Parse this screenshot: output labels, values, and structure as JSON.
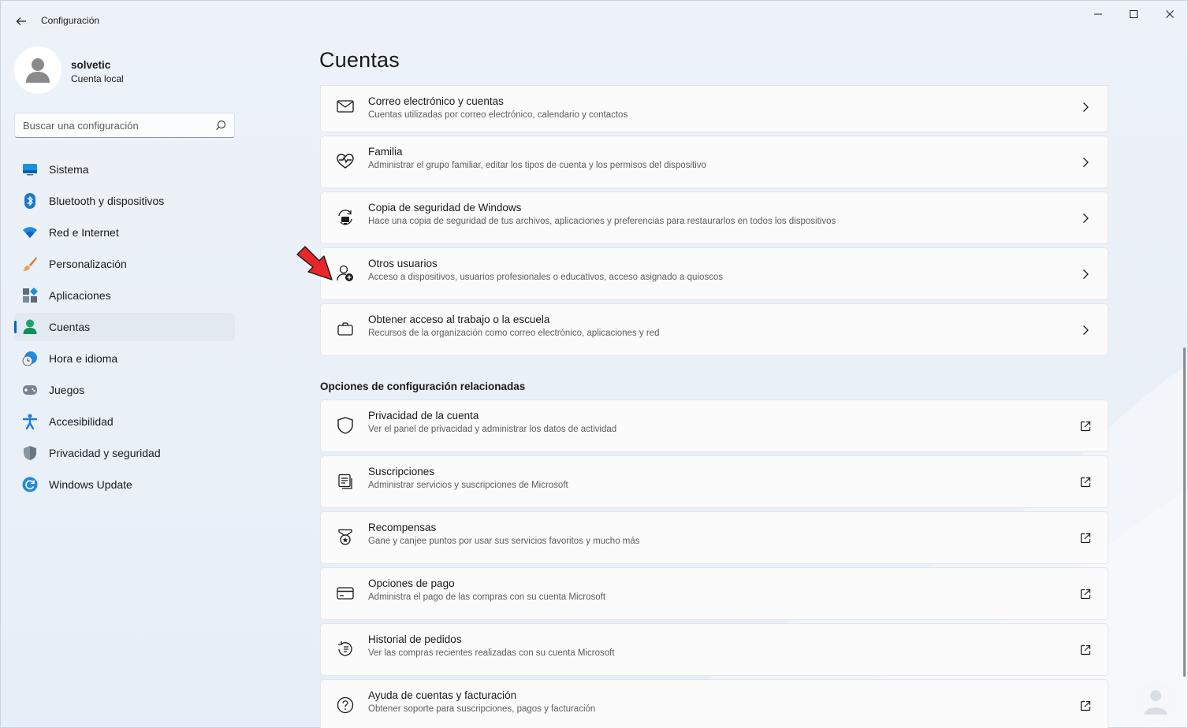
{
  "window": {
    "title": "Configuración"
  },
  "profile": {
    "name": "solvetic",
    "account_type": "Cuenta local"
  },
  "search": {
    "placeholder": "Buscar una configuración"
  },
  "nav": {
    "items": [
      {
        "label": "Sistema",
        "icon": "monitor-icon"
      },
      {
        "label": "Bluetooth y dispositivos",
        "icon": "bluetooth-icon"
      },
      {
        "label": "Red e Internet",
        "icon": "wifi-icon"
      },
      {
        "label": "Personalización",
        "icon": "brush-icon"
      },
      {
        "label": "Aplicaciones",
        "icon": "apps-icon"
      },
      {
        "label": "Cuentas",
        "icon": "account-icon",
        "active": true
      },
      {
        "label": "Hora e idioma",
        "icon": "clock-globe-icon"
      },
      {
        "label": "Juegos",
        "icon": "gamepad-icon"
      },
      {
        "label": "Accesibilidad",
        "icon": "accessibility-icon"
      },
      {
        "label": "Privacidad y seguridad",
        "icon": "shield-icon"
      },
      {
        "label": "Windows Update",
        "icon": "update-icon"
      }
    ]
  },
  "main": {
    "title": "Cuentas",
    "settings": [
      {
        "title": "Correo electrónico y cuentas",
        "subtitle": "Cuentas utilizadas por correo electrónico, calendario y contactos",
        "icon": "mail-icon"
      },
      {
        "title": "Familia",
        "subtitle": "Administrar el grupo familiar, editar los tipos de cuenta y los permisos del dispositivo",
        "icon": "family-heart-icon"
      },
      {
        "title": "Copia de seguridad de Windows",
        "subtitle": "Hace una copia de seguridad de tus archivos, aplicaciones y preferencias para restaurarlos en todos los dispositivos",
        "icon": "backup-icon"
      },
      {
        "title": "Otros usuarios",
        "subtitle": "Acceso a dispositivos, usuarios profesionales o educativos, acceso asignado a quioscos",
        "icon": "add-user-icon"
      },
      {
        "title": "Obtener acceso al trabajo o la escuela",
        "subtitle": "Recursos de la organización como correo electrónico, aplicaciones y red",
        "icon": "briefcase-icon"
      }
    ],
    "related_title": "Opciones de configuración relacionadas",
    "related": [
      {
        "title": "Privacidad de la cuenta",
        "subtitle": "Ver el panel de privacidad y administrar los datos de actividad",
        "icon": "shield-outline-icon"
      },
      {
        "title": "Suscripciones",
        "subtitle": "Administrar servicios y suscripciones de Microsoft",
        "icon": "subscriptions-icon"
      },
      {
        "title": "Recompensas",
        "subtitle": "Gane y canjee puntos por usar sus servicios favoritos y mucho más",
        "icon": "rewards-icon"
      },
      {
        "title": "Opciones de pago",
        "subtitle": "Administra el pago de las compras con su cuenta Microsoft",
        "icon": "credit-card-icon"
      },
      {
        "title": "Historial de pedidos",
        "subtitle": "Ver las compras recientes realizadas con su cuenta Microsoft",
        "icon": "history-icon"
      },
      {
        "title": "Ayuda de cuentas y facturación",
        "subtitle": "Obtener soporte para suscripciones, pagos y facturación",
        "icon": "help-icon"
      }
    ]
  },
  "colors": {
    "accent": "#0067c0",
    "arrow": "#e8262b",
    "background": "#eef3f9",
    "card": "#fbfbfc"
  }
}
